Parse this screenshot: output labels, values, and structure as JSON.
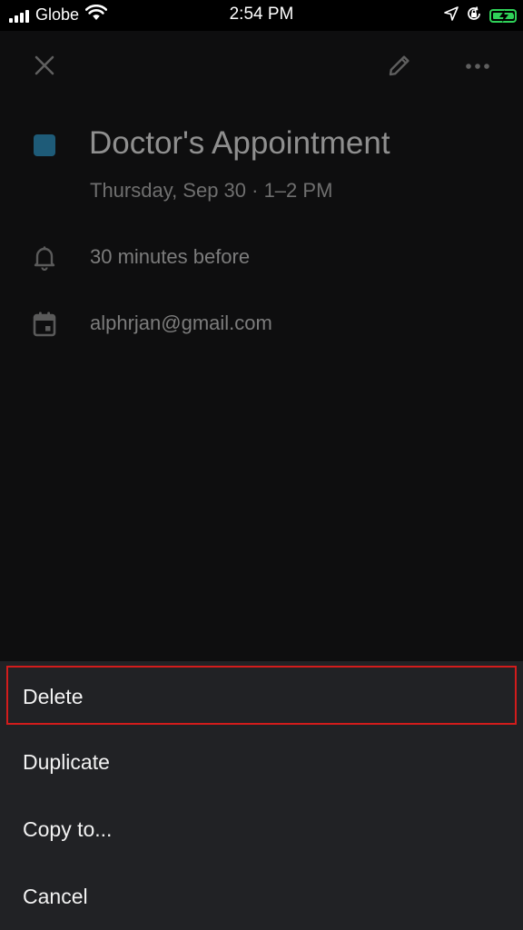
{
  "status_bar": {
    "carrier": "Globe",
    "time": "2:54 PM",
    "battery_color": "#2fd158"
  },
  "toolbar": {
    "icons": [
      "close-icon",
      "edit-pencil-icon",
      "more-horizontal-icon"
    ]
  },
  "event": {
    "title": "Doctor's Appointment",
    "date_time": "Thursday, Sep 30 · 1–2 PM",
    "color": "#1e5b78",
    "reminder": "30 minutes before",
    "calendar_account": "alphrjan@gmail.com"
  },
  "action_sheet": {
    "items": [
      {
        "label": "Delete",
        "highlighted": true
      },
      {
        "label": "Duplicate"
      },
      {
        "label": "Copy to..."
      },
      {
        "label": "Cancel"
      }
    ],
    "highlight_color": "#d21c1c"
  }
}
